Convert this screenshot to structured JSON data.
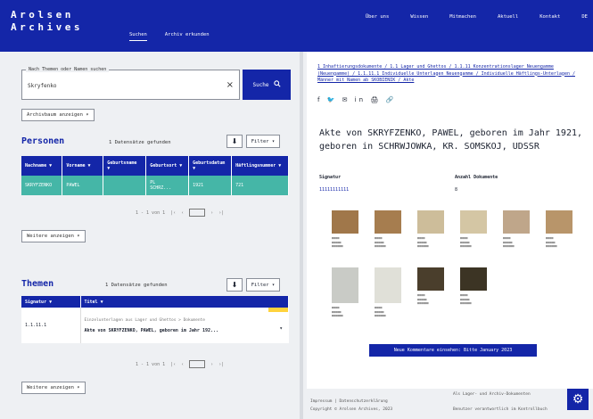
{
  "header": {
    "logo_line1": "Arolsen",
    "logo_line2": "Archives",
    "subnav": [
      "Suchen",
      "Archiv erkunden"
    ],
    "topnav": [
      "Über uns",
      "Wissen",
      "Mitmachen",
      "Aktuell",
      "Kontakt",
      "DE"
    ]
  },
  "search": {
    "legend": "Nach Themen oder Namen suchen",
    "value": "Skryfenko",
    "button_label": "Suche",
    "archive_tree_button": "Archivbaum anzeigen"
  },
  "persons": {
    "title": "Personen",
    "count_text": "1 Datensätze gefunden",
    "filter_label": "Filter",
    "columns": [
      "Nachname",
      "Vorname",
      "Geburtsname",
      "Geburtsort",
      "Geburtsdatum",
      "Häftlingsnummer"
    ],
    "rows": [
      [
        "SKRYFZENKO",
        "PAWEL",
        "",
        "PL\nSCHRZ...",
        "1921",
        "721"
      ]
    ],
    "pager": "1 - 1 von 1",
    "more_button": "Weitere anzeigen"
  },
  "topics": {
    "title": "Themen",
    "count_text": "1 Datensätze gefunden",
    "filter_label": "Filter",
    "columns": [
      "Signatur",
      "Titel"
    ],
    "rows": [
      {
        "signature": "1.1.11.1",
        "title_line1": "Einzelunterlagen aus Lager und Ghettos > Dokumente",
        "title_line2": "Akte von SKRYFZENKO, PAWEL, geboren im Jahr 192..."
      }
    ],
    "pager": "1 - 1 von 1",
    "more_button": "Weitere anzeigen"
  },
  "detail": {
    "breadcrumb": "1 Inhaftierungsdokumente / 1.1 Lager und Ghettos / 1.1.11 Konzentrationslager Neuengamme (Neuengamme) / 1.1.11.1 Individuelle Unterlagen Neuengamme / Individuelle Häftlings-Unterlagen / Männer mit Namen ab SKOBIENIK / Akte",
    "social_icons": "f 🐦 ✉ in 🖨 🔗",
    "title": "Akte von SKRYFZENKO, PAWEL, geboren im Jahr 1921, geboren in SCHRWJOWKA, KR. SOMSKOJ, UDSSR",
    "signature_label": "Signatur",
    "signature_value": "11111111111",
    "count_label": "Anzahl Dokumente",
    "count_value": "8",
    "banner": "Neue Kommentare einsehen: Bitte January 2023"
  },
  "footer": {
    "line1": "Impressum  |  Datenschutzerklärung",
    "line2": "Copyright © Arolsen Archives, 2023",
    "line3": "Als Lager- und Archiv-Dokumenten",
    "line4": "Benutzer verantwortlich im Kontrollbuch"
  },
  "colors": {
    "brand_blue": "#1426a8",
    "teal": "#45b6a7",
    "highlight_yellow": "#ffd33d"
  }
}
